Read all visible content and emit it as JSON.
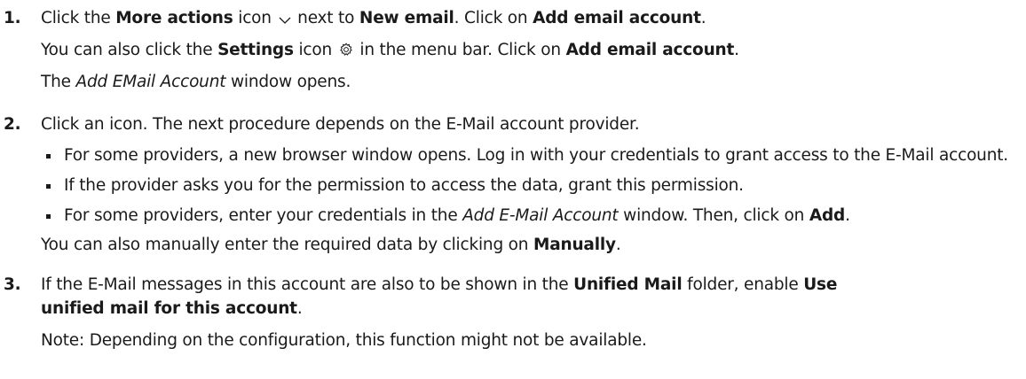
{
  "steps": [
    {
      "number": "1.",
      "line1": {
        "t1": "Click the ",
        "b1": "More actions",
        "t2": " icon ",
        "t3": " next to ",
        "b2": "New email",
        "t4": ". Click on ",
        "b3": "Add email account",
        "t5": "."
      },
      "line2": {
        "t1": "You can also click the ",
        "b1": "Settings",
        "t2": " icon ",
        "t3": " in the menu bar. Click on ",
        "b2": "Add email account",
        "t4": "."
      },
      "line3": {
        "t1": "The ",
        "i1": "Add EMail Account",
        "t2": " window opens."
      }
    },
    {
      "number": "2.",
      "line1": "Click an icon. The next procedure depends on the E-Mail account provider.",
      "bullets": {
        "b1": "For some providers, a new browser window opens. Log in with your credentials to grant access to the E-Mail account.",
        "b2": "If the provider asks you for the permission to access the data, grant this permission.",
        "b3": {
          "t1": "For some providers, enter your credentials in the ",
          "i1": "Add E-Mail Account",
          "t2": " window. Then, click on ",
          "b1": "Add",
          "t3": "."
        }
      },
      "line_after": {
        "t1": "You can also manually enter the required data by clicking on ",
        "b1": "Manually",
        "t2": "."
      }
    },
    {
      "number": "3.",
      "line1": {
        "t1": "If the E-Mail messages in this account are also to be shown in the ",
        "b1": "Unified Mail",
        "t2": " folder, enable ",
        "b2": "Use"
      },
      "line2": {
        "b1": "unified mail for this account",
        "t1": "."
      },
      "note": "Note: Depending on the configuration, this function might not be available."
    }
  ],
  "icons": {
    "more_actions": "chevron-down-icon",
    "settings": "gear-icon"
  }
}
